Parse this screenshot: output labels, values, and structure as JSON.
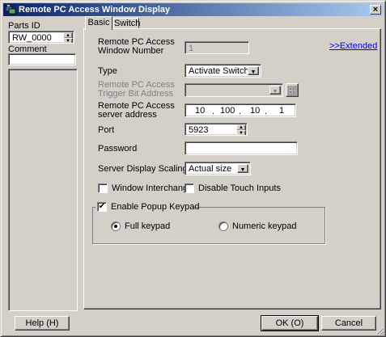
{
  "window": {
    "title": "Remote PC Access Window Display",
    "close_label": "×"
  },
  "left_panel": {
    "parts_id_label": "Parts ID",
    "parts_id_value": "RW_0000",
    "comment_label": "Comment",
    "comment_value": ""
  },
  "tabs": [
    {
      "label": "Basic"
    },
    {
      "label": "Switch"
    }
  ],
  "form": {
    "window_number_label_1": "Remote PC Access",
    "window_number_label_2": "Window Number",
    "window_number_value": "1",
    "extended_link": ">>Extended",
    "type_label": "Type",
    "type_value": "Activate Switch",
    "trigger_label_1": "Remote PC Access",
    "trigger_label_2": "Trigger Bit Address",
    "trigger_value": "",
    "server_label_1": "Remote PC Access",
    "server_label_2": "server address",
    "ip_octets": [
      "10",
      "100",
      "10",
      "1"
    ],
    "port_label": "Port",
    "port_value": "5923",
    "password_label": "Password",
    "password_value": "",
    "scaling_label": "Server Display Scaling",
    "scaling_value": "Actual size",
    "window_interchange_label": "Window Interchange",
    "window_interchange_checked": false,
    "disable_touch_label": "Disable Touch Inputs",
    "disable_touch_checked": false,
    "enable_popup_label": "Enable Popup Keypad",
    "enable_popup_checked": true,
    "full_keypad_label": "Full keypad",
    "numeric_keypad_label": "Numeric keypad",
    "keypad_selected": "Full keypad"
  },
  "buttons": {
    "help": "Help (H)",
    "ok": "OK (O)",
    "cancel": "Cancel"
  },
  "icons": {
    "app": "remote-pc-app-icon",
    "checkmark": "✔",
    "dropdown": "▼",
    "spin_up": "▲",
    "spin_down": "▼"
  },
  "colors": {
    "titlebar_start": "#0a246a",
    "titlebar_end": "#a6caf0",
    "face": "#d4d0c8",
    "link": "#0000ff"
  }
}
